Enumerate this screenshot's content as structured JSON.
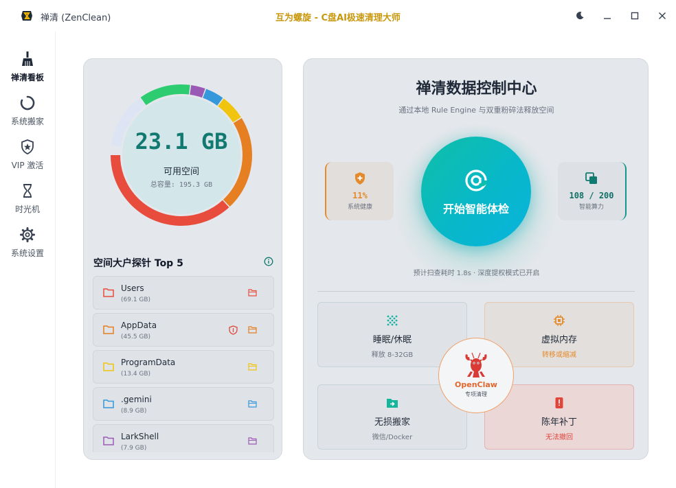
{
  "titlebar": {
    "app_name": "禅清 (ZenClean)",
    "center_title": "互为螺旋 - C盘AI极速清理大师"
  },
  "sidebar": {
    "items": [
      {
        "label": "禅清看板",
        "icon": "broom-icon"
      },
      {
        "label": "系统搬家",
        "icon": "refresh-icon"
      },
      {
        "label": "VIP 激活",
        "icon": "shield-star-icon"
      },
      {
        "label": "时光机",
        "icon": "hourglass-icon"
      },
      {
        "label": "系统设置",
        "icon": "gear-icon"
      }
    ]
  },
  "storage": {
    "available": "23.1 GB",
    "available_label": "可用空间",
    "total": "总容量: 195.3 GB",
    "ring": [
      {
        "color": "#e74c3c",
        "fraction": 0.37
      },
      {
        "color": "#e67e22",
        "fraction": 0.22
      },
      {
        "color": "#f1c40f",
        "fraction": 0.06
      },
      {
        "color": "#3498db",
        "fraction": 0.045
      },
      {
        "color": "#9b59b6",
        "fraction": 0.035
      },
      {
        "color": "#2ecc71",
        "fraction": 0.12
      },
      {
        "color": "#dde4f4",
        "fraction": 0.13
      }
    ]
  },
  "top5": {
    "title": "空间大户探针 Top 5",
    "items": [
      {
        "name": "Users",
        "size": "(69.1 GB)",
        "color": "#e74c3c",
        "shield": false
      },
      {
        "name": "AppData",
        "size": "(45.5 GB)",
        "color": "#e67e22",
        "shield": true
      },
      {
        "name": "ProgramData",
        "size": "(13.4 GB)",
        "color": "#f1c40f",
        "shield": false
      },
      {
        "name": ".gemini",
        "size": "(8.9 GB)",
        "color": "#3498db",
        "shield": false
      },
      {
        "name": "LarkShell",
        "size": "(7.9 GB)",
        "color": "#9b59b6",
        "shield": false
      }
    ]
  },
  "control": {
    "title": "禅清数据控制中心",
    "subtitle": "通过本地 Rule Engine 与双重粉碎法释放空间",
    "health_value": "11%",
    "health_label": "系统健康",
    "power_value": "108 / 200",
    "power_label": "智能算力",
    "scan_label": "开始智能体检",
    "hint": "预计扫查耗时 1.8s · 深度提权模式已开启"
  },
  "tools": {
    "sleep": {
      "name": "睡眠/休眠",
      "desc": "释放 8-32GB",
      "icon": "dots-grid-icon"
    },
    "memory": {
      "name": "虚拟内存",
      "desc": "转移或缩减",
      "icon": "chip-icon"
    },
    "move": {
      "name": "无损搬家",
      "desc": "微信/Docker",
      "icon": "folder-move-icon"
    },
    "patch": {
      "name": "陈年补丁",
      "desc": "无法撤回",
      "icon": "phone-alert-icon"
    }
  },
  "openclaw": {
    "name": "OpenClaw",
    "sub": "专项清理",
    "icon": "lobster-icon"
  },
  "colors": {
    "accent_teal": "#11796f",
    "orange": "#e58a2b",
    "red_text": "#e0453a",
    "gold_title": "#c9970c"
  }
}
